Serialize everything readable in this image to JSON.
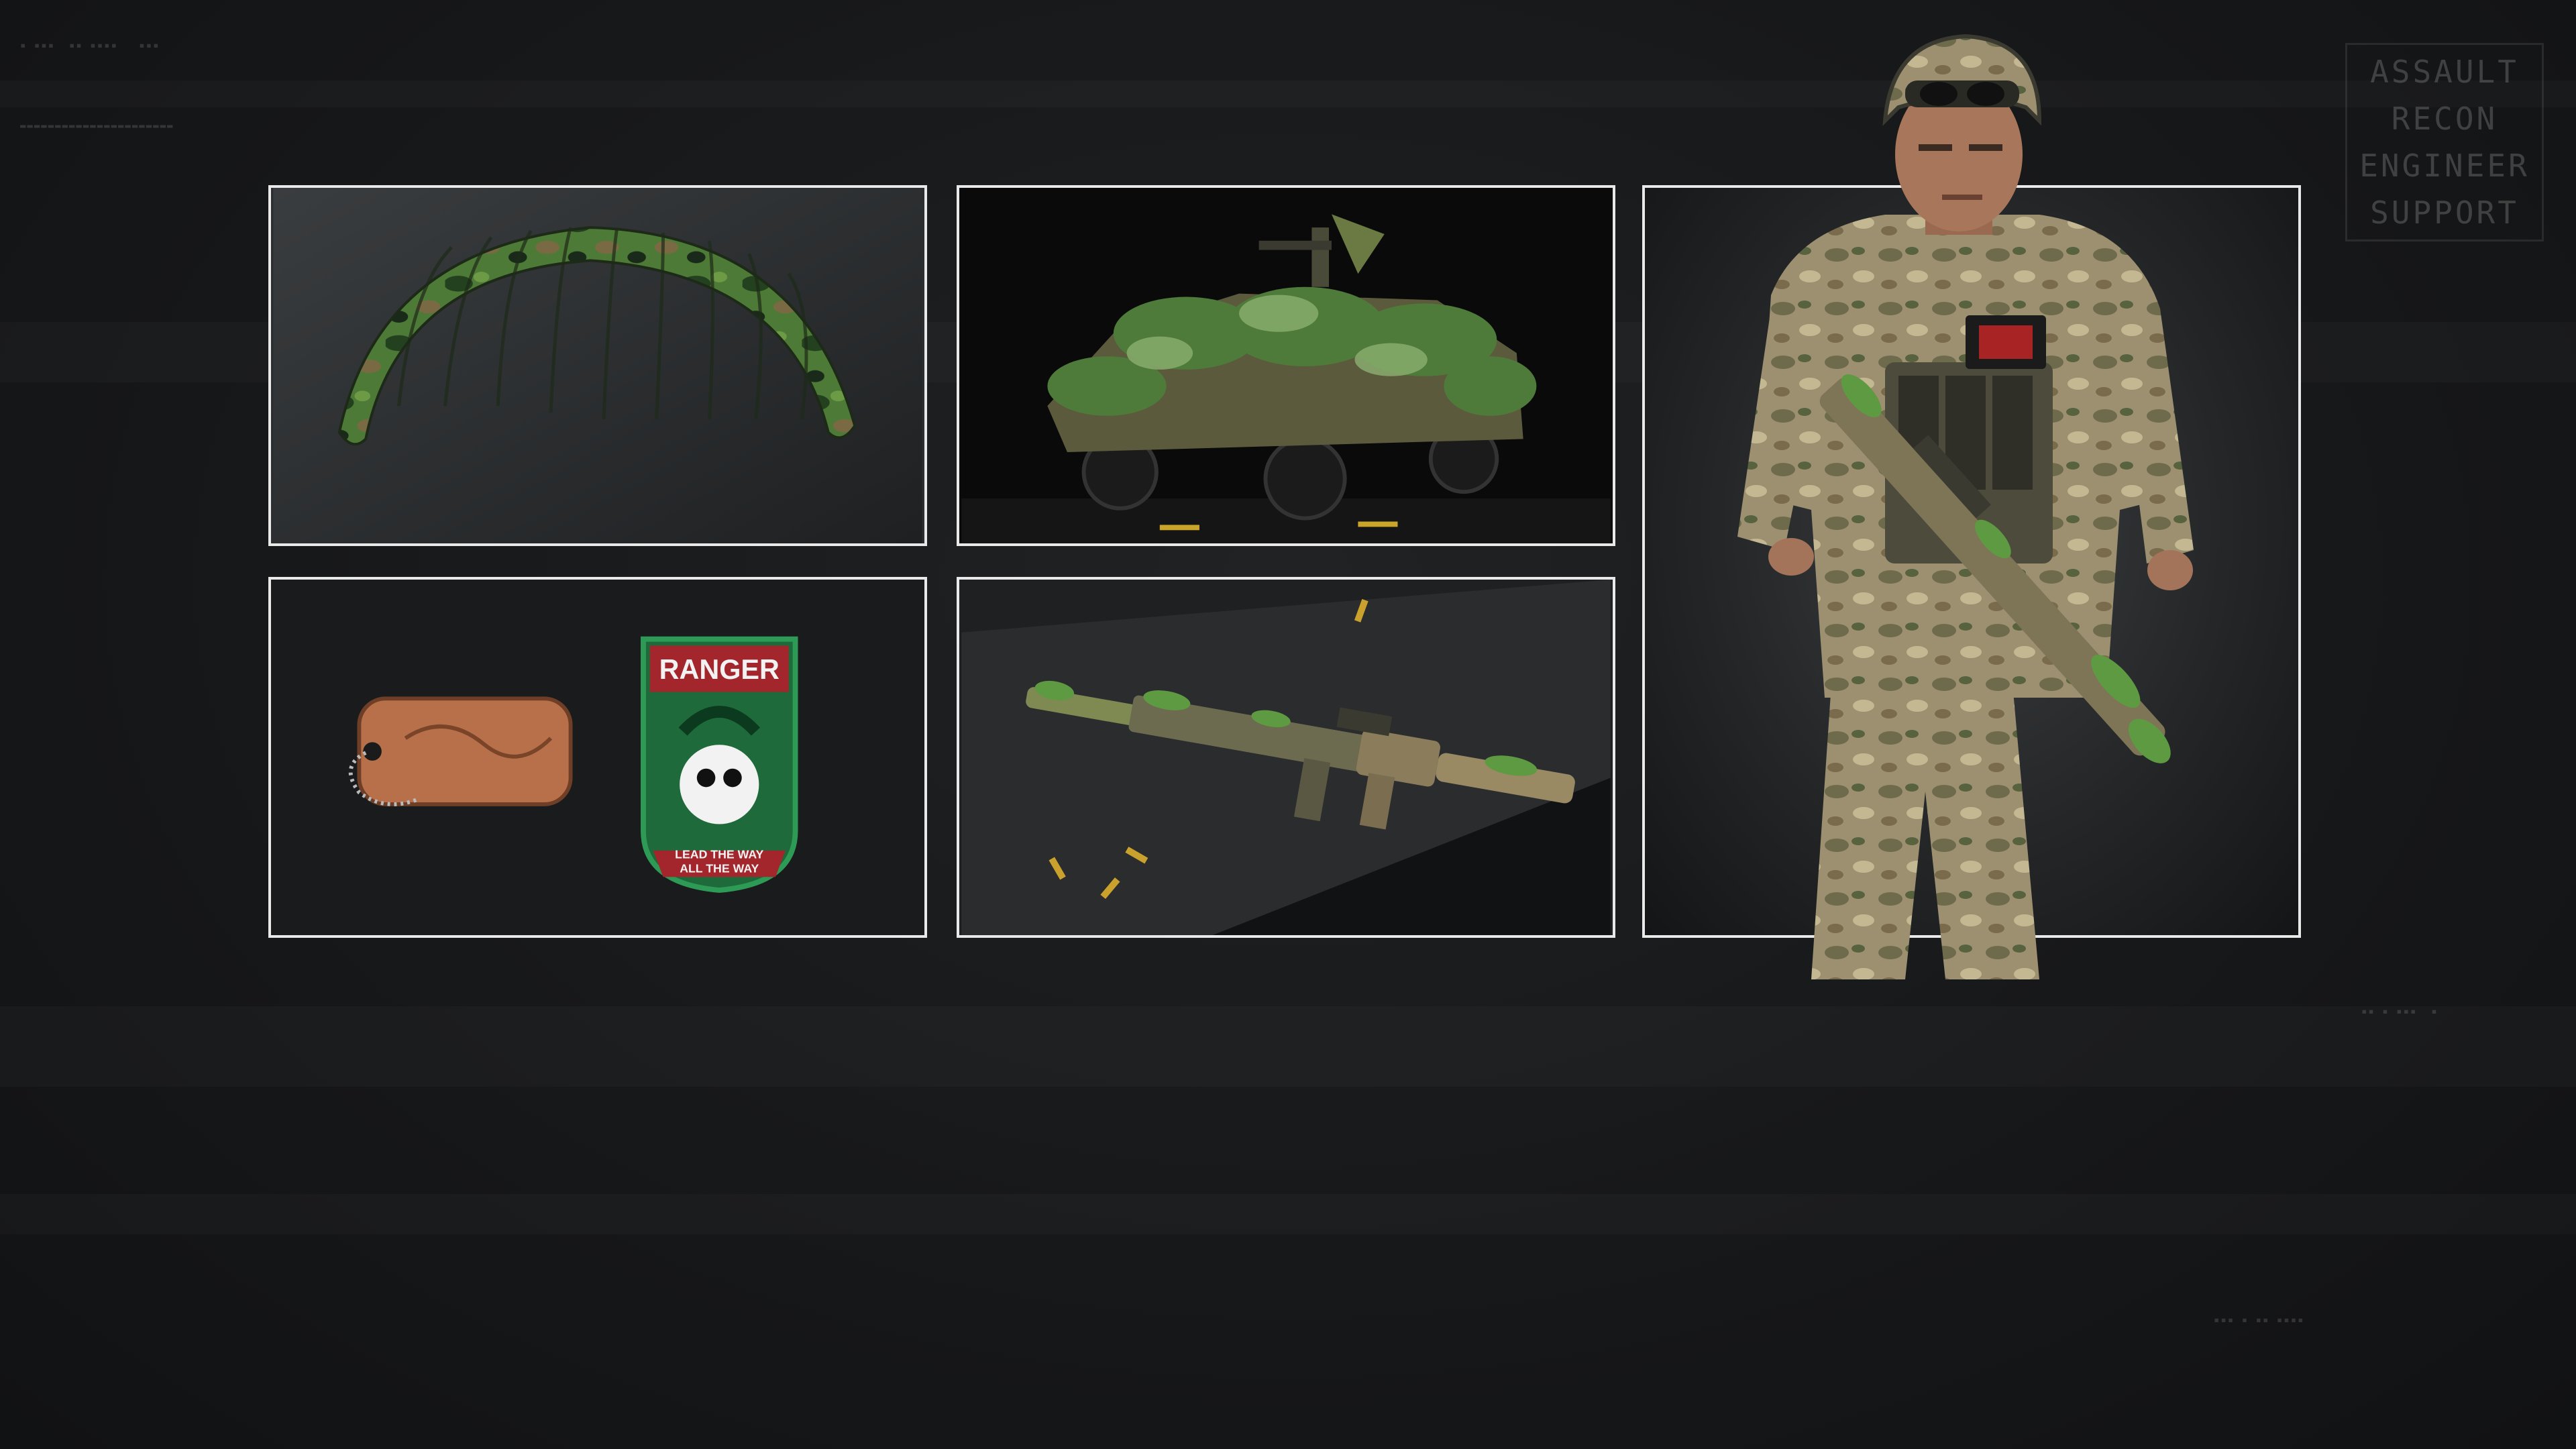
{
  "hud": {
    "class_list": [
      "ASSAULT",
      "RECON",
      "ENGINEER",
      "SUPPORT"
    ]
  },
  "tiles": {
    "parachute": {
      "name": "parachute-skin"
    },
    "vehicle": {
      "name": "vehicle-skin"
    },
    "tags": {
      "patch_title": "RANGER",
      "patch_motto_1": "LEAD THE WAY",
      "patch_motto_2": "ALL THE WAY"
    },
    "weapon": {
      "name": "weapon-blueprint"
    },
    "operator": {
      "name": "operator-skin"
    }
  },
  "colors": {
    "frame": "#e9e9e9",
    "camo_green": "#3f6b2f",
    "camo_dark": "#1f3a1c",
    "camo_tan": "#8a7a55",
    "patch_red": "#a2262c",
    "copper": "#b8704a"
  }
}
